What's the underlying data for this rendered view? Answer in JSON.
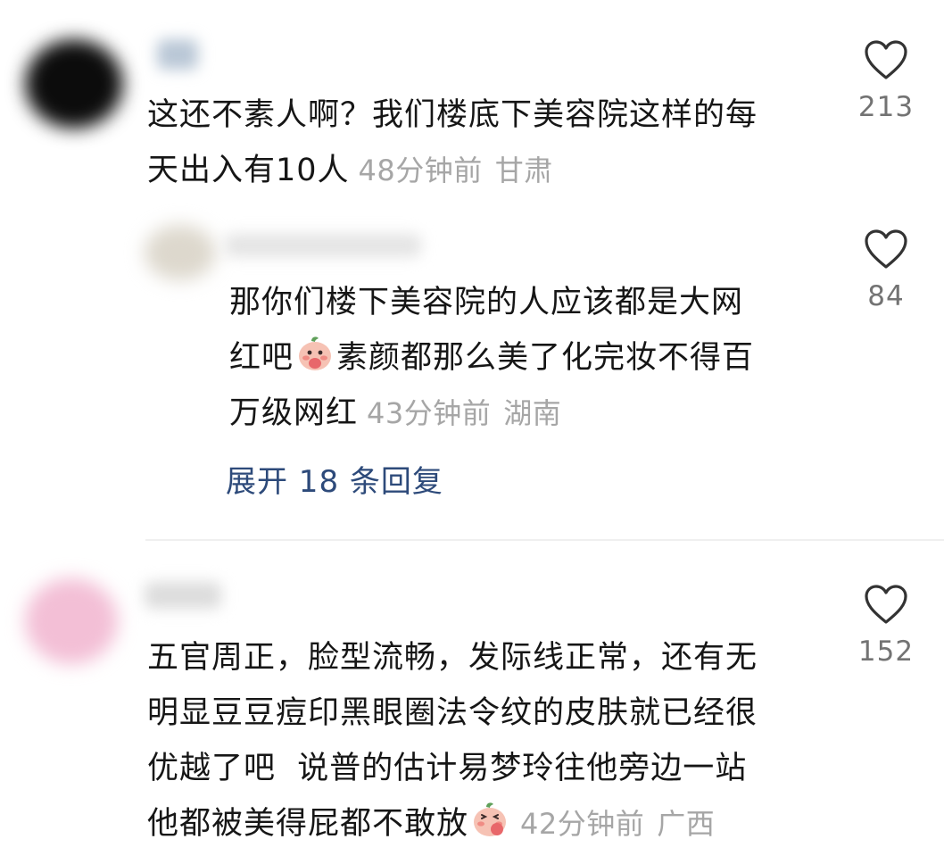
{
  "comments": [
    {
      "text_lines": [
        "这还不素人啊？我们楼底下美容院这样的每",
        "天出入有10人"
      ],
      "time": "48分钟前",
      "location": "甘肃",
      "likes": "213"
    },
    {
      "text_lines": [
        "那你们楼下美容院的人应该都是大网",
        "红吧",
        "素颜都那么美了化完妆不得百",
        "万级网红"
      ],
      "time": "43分钟前",
      "location": "湖南",
      "likes": "84",
      "expand_label": "展开 18 条回复"
    },
    {
      "text_lines": [
        "五官周正，脸型流畅，发际线正常，还有无",
        "明显豆豆痘印黑眼圈法令纹的皮肤就已经很",
        "优越了吧  说普的估计易梦玲往他旁边一站",
        "他都被美得屁都不敢放"
      ],
      "time": "42分钟前",
      "location": "广西",
      "likes": "152"
    }
  ],
  "icons": {
    "like": "heart-outline-icon",
    "emoji": "blushing-peach-emoji-icon"
  },
  "colors": {
    "text": "#161616",
    "meta": "#a6a6a6",
    "like_count": "#737373",
    "expand_link": "#2d4a7a",
    "divider": "#efefef"
  }
}
